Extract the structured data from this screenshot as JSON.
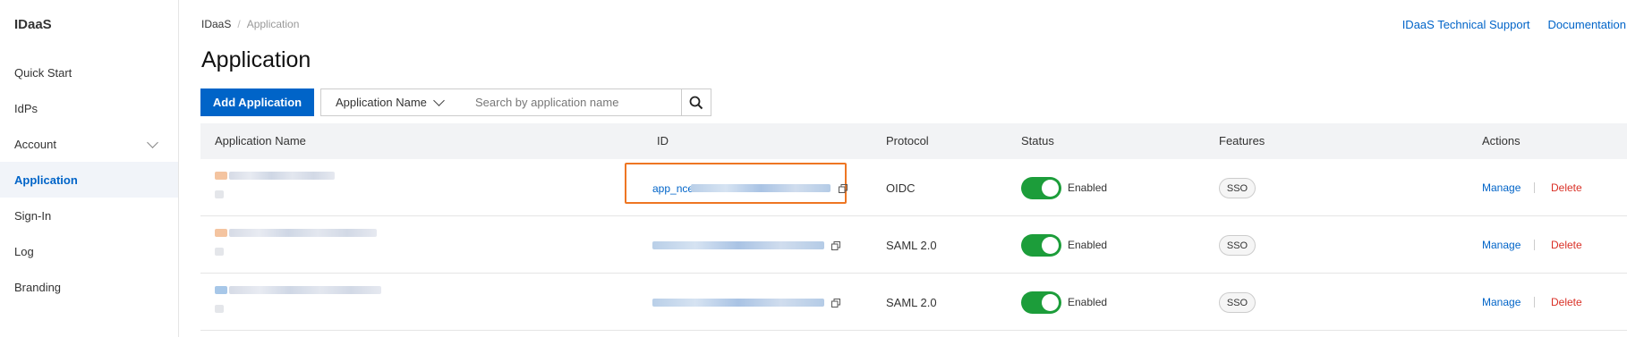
{
  "sidebar": {
    "brand": "IDaaS",
    "items": [
      {
        "label": "Quick Start"
      },
      {
        "label": "IdPs"
      },
      {
        "label": "Account"
      },
      {
        "label": "Application"
      },
      {
        "label": "Sign-In"
      },
      {
        "label": "Log"
      },
      {
        "label": "Branding"
      }
    ]
  },
  "breadcrumb": {
    "root": "IDaaS",
    "separator": "/",
    "current": "Application"
  },
  "top_links": {
    "support": "IDaaS Technical Support",
    "docs": "Documentation"
  },
  "page": {
    "title": "Application"
  },
  "toolbar": {
    "add_button": "Add Application",
    "filter_select": "Application Name",
    "search_placeholder": "Search by application name"
  },
  "table": {
    "headers": {
      "name": "Application Name",
      "id": "ID",
      "protocol": "Protocol",
      "status": "Status",
      "features": "Features",
      "actions": "Actions"
    },
    "rows": [
      {
        "id_prefix": "app_nce",
        "protocol": "OIDC",
        "status": "Enabled",
        "feature": "SSO",
        "manage": "Manage",
        "delete": "Delete"
      },
      {
        "id_prefix": "",
        "protocol": "SAML 2.0",
        "status": "Enabled",
        "feature": "SSO",
        "manage": "Manage",
        "delete": "Delete"
      },
      {
        "id_prefix": "",
        "protocol": "SAML 2.0",
        "status": "Enabled",
        "feature": "SSO",
        "manage": "Manage",
        "delete": "Delete"
      }
    ]
  },
  "colors": {
    "primary": "#0064c8",
    "enabled_toggle": "#1c9d3a",
    "delete": "#d93026",
    "highlight": "#ee7623"
  },
  "icons": [
    "search-icon",
    "copy-icon",
    "chevron-down-icon"
  ]
}
